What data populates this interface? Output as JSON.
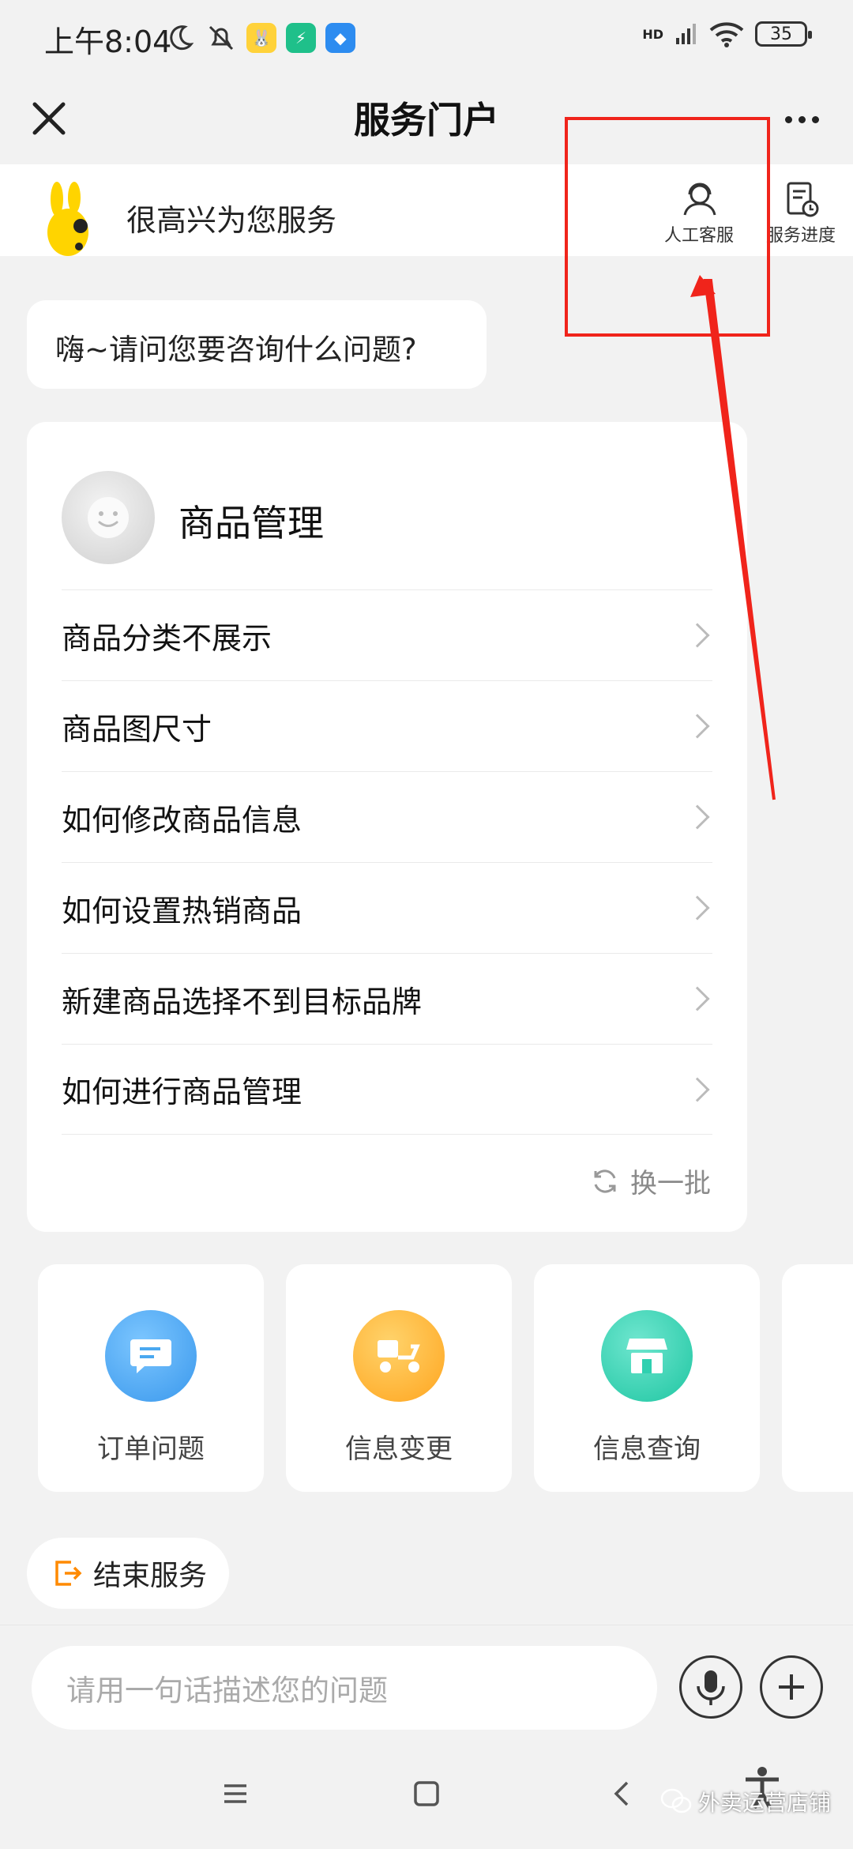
{
  "status_bar": {
    "time": "上午8:04",
    "network": "HD",
    "battery": "35"
  },
  "header": {
    "title": "服务门户"
  },
  "welcome": {
    "text": "很高兴为您服务",
    "actions": [
      {
        "label": "人工客服"
      },
      {
        "label": "服务进度"
      }
    ]
  },
  "greeting": "嗨~请问您要咨询什么问题?",
  "faq_card": {
    "title": "商品管理",
    "items": [
      "商品分类不展示",
      "商品图尺寸",
      "如何修改商品信息",
      "如何设置热销商品",
      "新建商品选择不到目标品牌",
      "如何进行商品管理"
    ],
    "refresh_label": "换一批"
  },
  "shortcuts": [
    {
      "label": "订单问题",
      "color": "#4aa8f0"
    },
    {
      "label": "信息变更",
      "color": "#ffb02e"
    },
    {
      "label": "信息查询",
      "color": "#2fd0b0"
    }
  ],
  "end_service": "结束服务",
  "input": {
    "placeholder": "请用一句话描述您的问题"
  },
  "watermark": "外卖运营店铺",
  "colors": {
    "annotation": "#f0241b",
    "accent_orange": "#ff8a00"
  }
}
